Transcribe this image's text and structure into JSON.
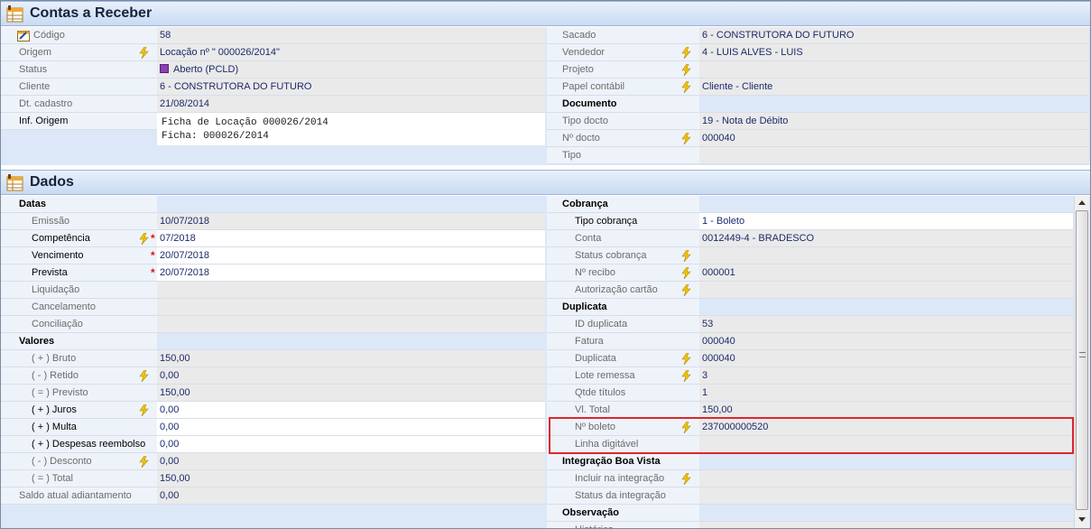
{
  "contas": {
    "title": "Contas a Receber",
    "left": [
      {
        "label": "Código",
        "value": "58",
        "icon": "calendar-icon"
      },
      {
        "label": "Origem",
        "value": "Locação nº \" 000026/2014\"",
        "bolt": true
      },
      {
        "label": "Status",
        "value": "Aberto (PCLD)"
      },
      {
        "label": "Cliente",
        "value": "6 - CONSTRUTORA DO FUTURO"
      },
      {
        "label": "Dt. cadastro",
        "value": "21/08/2014"
      },
      {
        "label": "Inf. Origem",
        "memo": "Ficha de Locação 000026/2014\nFicha: 000026/2014"
      }
    ],
    "right": [
      {
        "label": "Sacado",
        "value": "6 - CONSTRUTORA DO FUTURO"
      },
      {
        "label": "Vendedor",
        "value": "4 - LUIS ALVES - LUIS",
        "bolt": true
      },
      {
        "label": "Projeto",
        "value": "",
        "bolt": true
      },
      {
        "label": "Papel contábil",
        "value": "Cliente - Cliente",
        "bolt": true
      },
      {
        "label": "Documento",
        "group": true
      },
      {
        "label": "Tipo docto",
        "value": "19 - Nota de Débito"
      },
      {
        "label": "Nº docto",
        "value": "000040",
        "bolt": true
      },
      {
        "label": "Tipo",
        "value": ""
      }
    ]
  },
  "dados": {
    "title": "Dados",
    "left": [
      {
        "label": "Datas",
        "group": true
      },
      {
        "label": "Emissão",
        "value": "10/07/2018"
      },
      {
        "label": "Competência",
        "value": "07/2018",
        "bolt": true,
        "req": "*",
        "white": true,
        "active": true
      },
      {
        "label": "Vencimento",
        "value": "20/07/2018",
        "req": "*",
        "white": true,
        "active": true
      },
      {
        "label": "Prevista",
        "value": "20/07/2018",
        "req": "*",
        "white": true,
        "active": true
      },
      {
        "label": "Liquidação",
        "value": ""
      },
      {
        "label": "Cancelamento",
        "value": ""
      },
      {
        "label": "Conciliação",
        "value": ""
      },
      {
        "label": "Valores",
        "group": true
      },
      {
        "label": "( + ) Bruto",
        "value": "150,00"
      },
      {
        "label": "( - ) Retido",
        "value": "0,00",
        "bolt": true
      },
      {
        "label": "( = ) Previsto",
        "value": "150,00"
      },
      {
        "label": "( + ) Juros",
        "value": "0,00",
        "bolt": true,
        "white": true,
        "active": true
      },
      {
        "label": "( + ) Multa",
        "value": "0,00",
        "white": true,
        "active": true
      },
      {
        "label": "( + ) Despesas reembolso",
        "value": "0,00",
        "white": true,
        "active": true
      },
      {
        "label": "( - ) Desconto",
        "value": "0,00",
        "bolt": true
      },
      {
        "label": "( = ) Total",
        "value": "150,00"
      },
      {
        "label": "Saldo atual adiantamento",
        "value": "0,00",
        "noindent": true
      }
    ],
    "right": [
      {
        "label": "Cobrança",
        "group": true
      },
      {
        "label": "Tipo cobrança",
        "value": "1 - Boleto",
        "white": true,
        "active": true
      },
      {
        "label": "Conta",
        "value": "0012449-4 - BRADESCO"
      },
      {
        "label": "Status cobrança",
        "value": "",
        "bolt": true
      },
      {
        "label": "Nº recibo",
        "value": "000001",
        "bolt": true
      },
      {
        "label": "Autorização cartão",
        "value": "",
        "bolt": true
      },
      {
        "label": "Duplicata",
        "group": true
      },
      {
        "label": "ID duplicata",
        "value": "53"
      },
      {
        "label": "Fatura",
        "value": "000040"
      },
      {
        "label": "Duplicata",
        "value": "000040",
        "bolt": true
      },
      {
        "label": "Lote remessa",
        "value": "3",
        "bolt": true
      },
      {
        "label": "Qtde títulos",
        "value": "1"
      },
      {
        "label": "Vl. Total",
        "value": "150,00"
      },
      {
        "label": "Nº boleto",
        "value": "237000000520",
        "bolt": true
      },
      {
        "label": "Linha digitável",
        "value": ""
      },
      {
        "label": "Integração Boa Vista",
        "group": true
      },
      {
        "label": "Incluir na integração",
        "value": "",
        "bolt": true
      },
      {
        "label": "Status da integração",
        "value": ""
      },
      {
        "label": "Observação",
        "group": true
      },
      {
        "label": "Histórico",
        "value": ""
      }
    ]
  },
  "colors": {
    "highlight": "#e0242c",
    "header": "#c9daf3",
    "value_text": "#1b2a6b"
  }
}
